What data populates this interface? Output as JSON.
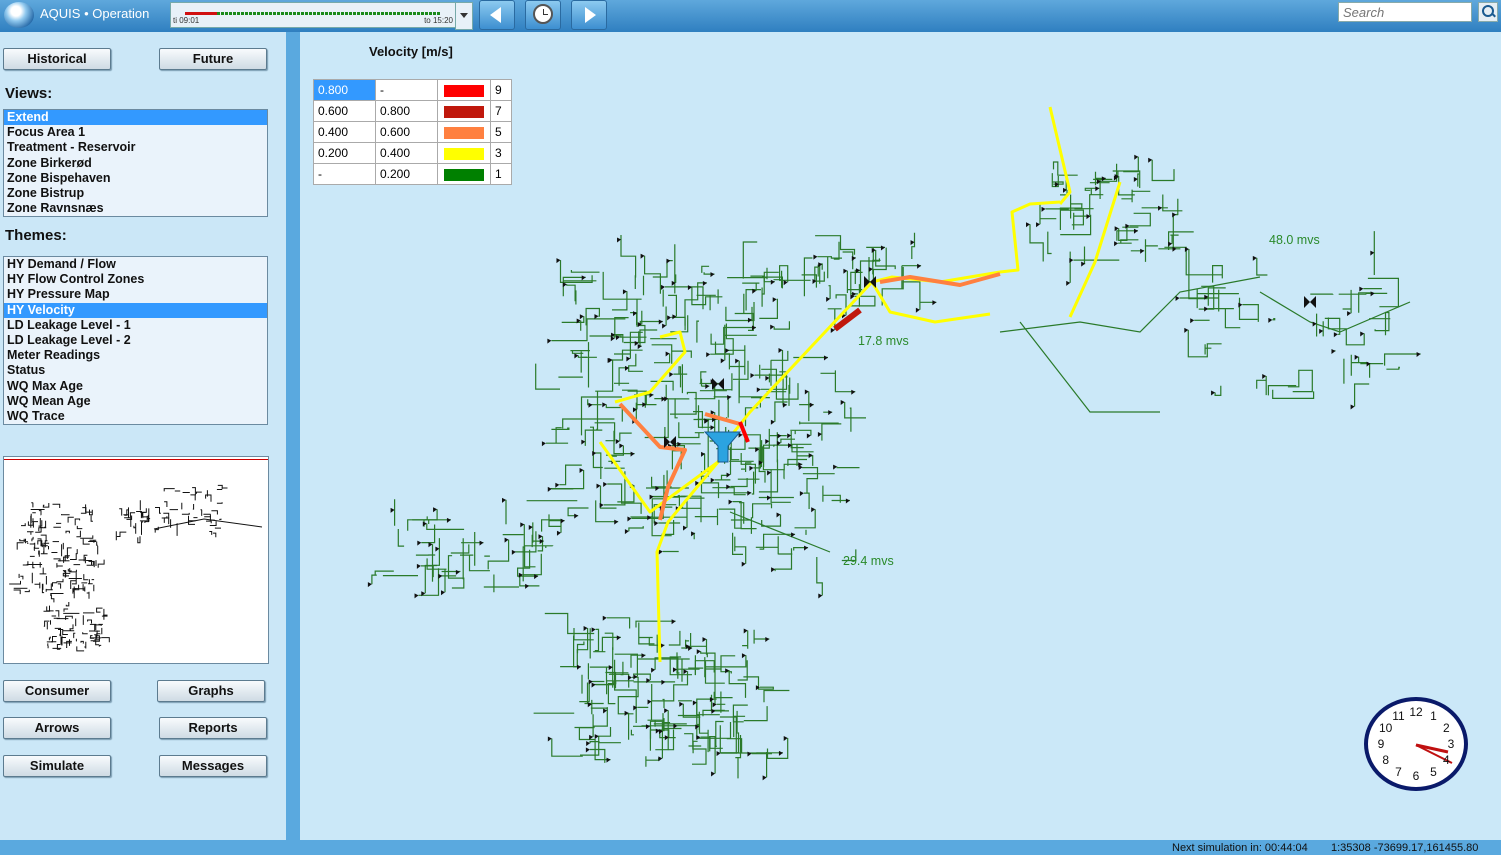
{
  "app": {
    "title": "AQUIS • Operation"
  },
  "timeline": {
    "start": "ti 09:01",
    "end": "to 15:20"
  },
  "search": {
    "placeholder": "Search"
  },
  "sidebar": {
    "historical_label": "Historical",
    "future_label": "Future",
    "views_heading": "Views:",
    "views": [
      "Extend",
      "Focus Area 1",
      "Treatment - Reservoir",
      "Zone Birkerød",
      "Zone Bispehaven",
      "Zone Bistrup",
      "Zone Ravnsnæs"
    ],
    "views_selected": "Extend",
    "themes_heading": "Themes:",
    "themes": [
      "HY Demand / Flow",
      "HY Flow Control Zones",
      "HY Pressure Map",
      "HY Velocity",
      "LD Leakage Level - 1",
      "LD Leakage Level - 2",
      "Meter Readings",
      "Status",
      "WQ Max Age",
      "WQ Mean Age",
      "WQ Trace"
    ],
    "themes_selected": "HY Velocity",
    "buttons": {
      "consumer": "Consumer",
      "graphs": "Graphs",
      "arrows": "Arrows",
      "reports": "Reports",
      "simulate": "Simulate",
      "messages": "Messages"
    }
  },
  "legend": {
    "title": "Velocity [m/s]",
    "rows": [
      {
        "from": "0.800",
        "to": "-",
        "color": "#ff0000",
        "count": "9"
      },
      {
        "from": "0.600",
        "to": "0.800",
        "color": "#c0180c",
        "count": "7"
      },
      {
        "from": "0.400",
        "to": "0.600",
        "color": "#ff8040",
        "count": "5"
      },
      {
        "from": "0.200",
        "to": "0.400",
        "color": "#ffff00",
        "count": "3"
      },
      {
        "from": "-",
        "to": "0.200",
        "color": "#008000",
        "count": "1"
      }
    ]
  },
  "map_labels": {
    "label_a": "48.0 mvs",
    "label_b": "17.8 mvs",
    "label_c": "29.4 mvs"
  },
  "clock": {
    "numbers": [
      "12",
      "1",
      "2",
      "3",
      "4",
      "5",
      "6",
      "7",
      "8",
      "9",
      "10",
      "11"
    ]
  },
  "status": {
    "next_simulation": "Next simulation in: 00:44:04",
    "scale_coords": "1:35308  -73699.17,161455.80"
  },
  "colors": {
    "topbar": "#3f8fd0",
    "panel": "#cbe7f7",
    "accent": "#3399ff",
    "pipe_green": "#2a7a2a"
  }
}
